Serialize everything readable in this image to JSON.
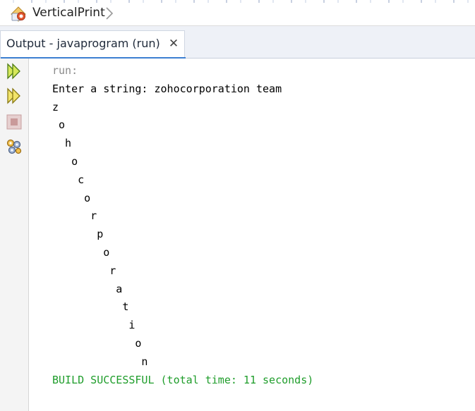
{
  "editor_breadcrumb": {
    "title": "VerticalPrint",
    "icon": "java-class-icon"
  },
  "output_tab": {
    "label": "Output - javaprogram (run)",
    "close_glyph": "✕",
    "accent_color": "#3c7fd1"
  },
  "toolbar": {
    "buttons": [
      {
        "name": "rerun-icon",
        "enabled": true
      },
      {
        "name": "rerun-with-options-icon",
        "enabled": true
      },
      {
        "name": "stop-icon",
        "enabled": false
      },
      {
        "name": "settings-icon",
        "enabled": true
      }
    ]
  },
  "console": {
    "lines": [
      {
        "text": "run:",
        "style": "muted"
      },
      {
        "text": "Enter a string: zohocorporation team",
        "style": "normal"
      },
      {
        "text": "z",
        "style": "normal"
      },
      {
        "text": " o",
        "style": "normal"
      },
      {
        "text": "  h",
        "style": "normal"
      },
      {
        "text": "   o",
        "style": "normal"
      },
      {
        "text": "    c",
        "style": "normal"
      },
      {
        "text": "     o",
        "style": "normal"
      },
      {
        "text": "      r",
        "style": "normal"
      },
      {
        "text": "       p",
        "style": "normal"
      },
      {
        "text": "        o",
        "style": "normal"
      },
      {
        "text": "         r",
        "style": "normal"
      },
      {
        "text": "          a",
        "style": "normal"
      },
      {
        "text": "           t",
        "style": "normal"
      },
      {
        "text": "            i",
        "style": "normal"
      },
      {
        "text": "             o",
        "style": "normal"
      },
      {
        "text": "              n",
        "style": "normal"
      },
      {
        "text": "BUILD SUCCESSFUL (total time: 11 seconds)",
        "style": "ok"
      }
    ],
    "colors": {
      "muted": "#8a8a8a",
      "success": "#1f9d2b"
    }
  }
}
